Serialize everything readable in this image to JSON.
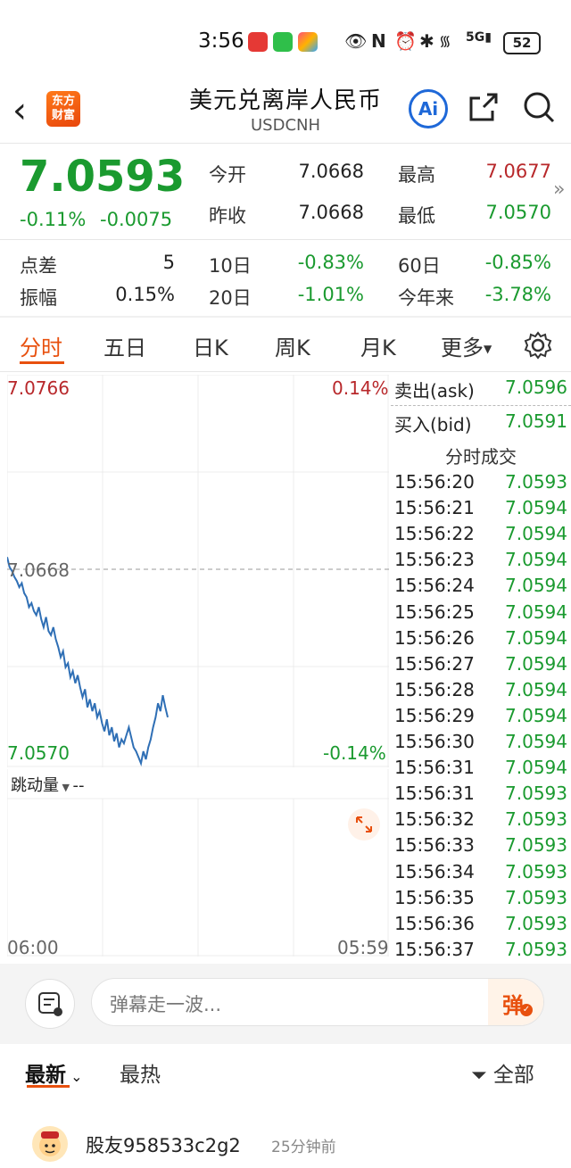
{
  "status_bar": {
    "time": "3:56",
    "battery": "52"
  },
  "header": {
    "title": "美元兑离岸人民币",
    "subtitle": "USDCNH",
    "logo_line1": "东方",
    "logo_line2": "财富",
    "ai_label": "Ai"
  },
  "quote": {
    "price": "7.0593",
    "change_pct": "-0.11%",
    "change_abs": "-0.0075",
    "open_label": "今开",
    "open": "7.0668",
    "prev_close_label": "昨收",
    "prev_close": "7.0668",
    "high_label": "最高",
    "high": "7.0677",
    "low_label": "最低",
    "low": "7.0570",
    "spread_label": "点差",
    "spread": "5",
    "amplitude_label": "振幅",
    "amplitude": "0.15%",
    "d10_label": "10日",
    "d10": "-0.83%",
    "d20_label": "20日",
    "d20": "-1.01%",
    "d60_label": "60日",
    "d60": "-0.85%",
    "ytd_label": "今年来",
    "ytd": "-3.78%"
  },
  "tabs": [
    "分时",
    "五日",
    "日K",
    "周K",
    "月K",
    "更多"
  ],
  "chart": {
    "y_max": "7.0766",
    "y_max_pct": "0.14%",
    "ref": "7.0668",
    "y_min": "7.0570",
    "y_min_pct": "-0.14%",
    "volume_selector": "跳动量",
    "volume_value": "--",
    "x_start": "06:00",
    "x_end": "05:59",
    "line_color": "#2f6fb5"
  },
  "chart_data": {
    "type": "line",
    "x_label": "",
    "y_label": "",
    "ylim": [
      7.057,
      7.0766
    ],
    "reference": 7.0668,
    "series": [
      {
        "values": [
          7.0675,
          7.067,
          7.0668,
          7.0665,
          7.0663,
          7.066,
          7.0662,
          7.0657,
          7.0655,
          7.065,
          7.0652,
          7.0648,
          7.0646,
          7.065,
          7.0644,
          7.064,
          7.0645,
          7.0638,
          7.0636,
          7.064,
          7.0634,
          7.063,
          7.0625,
          7.0628,
          7.062,
          7.0622,
          7.0615,
          7.0618,
          7.0612,
          7.0616,
          7.061,
          7.0605,
          7.0609,
          7.06,
          7.0604,
          7.0598,
          7.0602,
          7.0595,
          7.0598,
          7.0592,
          7.0588,
          7.0594,
          7.0586,
          7.059,
          7.0583,
          7.0587,
          7.058,
          7.0584,
          7.0582,
          7.0586,
          7.059,
          7.0585,
          7.058,
          7.0578,
          7.0575,
          7.0572,
          7.0578,
          7.0574,
          7.058,
          7.0584,
          7.059,
          7.0595,
          7.0602,
          7.0598,
          7.0606,
          7.06,
          7.0595
        ]
      }
    ]
  },
  "ticks_panel": {
    "ask_label": "卖出(ask)",
    "ask": "7.0596",
    "bid_label": "买入(bid)",
    "bid": "7.0591",
    "section_title": "分时成交",
    "rows": [
      {
        "t": "15:56:20",
        "p": "7.0593"
      },
      {
        "t": "15:56:21",
        "p": "7.0594"
      },
      {
        "t": "15:56:22",
        "p": "7.0594"
      },
      {
        "t": "15:56:23",
        "p": "7.0594"
      },
      {
        "t": "15:56:24",
        "p": "7.0594"
      },
      {
        "t": "15:56:25",
        "p": "7.0594"
      },
      {
        "t": "15:56:26",
        "p": "7.0594"
      },
      {
        "t": "15:56:27",
        "p": "7.0594"
      },
      {
        "t": "15:56:28",
        "p": "7.0594"
      },
      {
        "t": "15:56:29",
        "p": "7.0594"
      },
      {
        "t": "15:56:30",
        "p": "7.0594"
      },
      {
        "t": "15:56:31",
        "p": "7.0594"
      },
      {
        "t": "15:56:31",
        "p": "7.0593"
      },
      {
        "t": "15:56:32",
        "p": "7.0593"
      },
      {
        "t": "15:56:33",
        "p": "7.0593"
      },
      {
        "t": "15:56:34",
        "p": "7.0593"
      },
      {
        "t": "15:56:35",
        "p": "7.0593"
      },
      {
        "t": "15:56:36",
        "p": "7.0593"
      },
      {
        "t": "15:56:37",
        "p": "7.0593"
      }
    ]
  },
  "comment_bar": {
    "placeholder": "弹幕走一波...",
    "danmu": "弹"
  },
  "comments": {
    "sort_latest": "最新",
    "sort_hot": "最热",
    "filter": "全部",
    "first_user": "股友958533c2g2",
    "first_time": "25分钟前"
  }
}
